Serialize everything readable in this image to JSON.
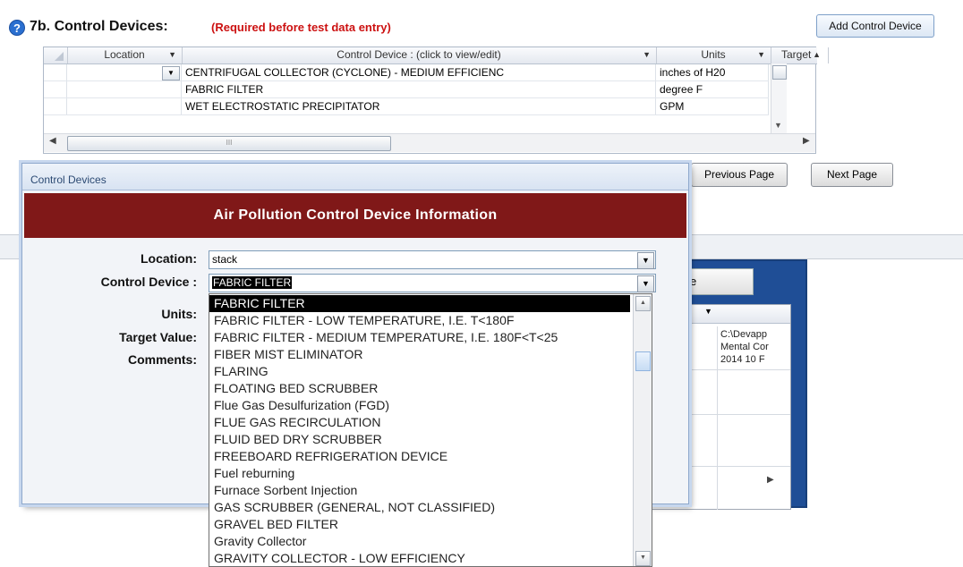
{
  "header": {
    "help_icon": "?",
    "title": "7b.  Control Devices:",
    "required_note": "(Required before test data entry)",
    "add_button": "Add Control Device"
  },
  "grid": {
    "columns": [
      "Location",
      "Control Device :  (click to view/edit)",
      "Units",
      "Target"
    ],
    "rows": [
      {
        "location": "",
        "device": "CENTRIFUGAL COLLECTOR (CYCLONE) - MEDIUM EFFICIENC",
        "units": "inches of H20"
      },
      {
        "location": "",
        "device": "FABRIC FILTER",
        "units": "degree F"
      },
      {
        "location": "",
        "device": "WET ELECTROSTATIC PRECIPITATOR",
        "units": "GPM"
      }
    ],
    "scroll_grip": "III"
  },
  "paging": {
    "previous": "Previous Page",
    "next": "Next Page"
  },
  "background": {
    "button_fragment": "e",
    "path_lines": [
      "C:\\Devapp",
      "Mental Cor",
      "2014 10 F"
    ]
  },
  "dialog": {
    "title": "Control Devices",
    "banner": "Air Pollution Control Device  Information",
    "location_label": "Location:",
    "location_value": "stack",
    "device_label": "Control Device :",
    "device_value": "FABRIC FILTER",
    "units_label": "Units:",
    "target_label": "Target Value:",
    "comments_label": "Comments:"
  },
  "dropdown": {
    "selected_index": 0,
    "items": [
      "FABRIC FILTER",
      "FABRIC FILTER - LOW TEMPERATURE, I.E. T<180F",
      "FABRIC FILTER - MEDIUM TEMPERATURE, I.E. 180F<T<25",
      "FIBER MIST ELIMINATOR",
      "FLARING",
      "FLOATING BED SCRUBBER",
      "Flue Gas Desulfurization (FGD)",
      "FLUE GAS RECIRCULATION",
      "FLUID BED DRY SCRUBBER",
      "FREEBOARD REFRIGERATION DEVICE",
      "Fuel reburning",
      "Furnace Sorbent Injection",
      "GAS SCRUBBER (GENERAL, NOT CLASSIFIED)",
      "GRAVEL BED FILTER",
      "Gravity Collector",
      "GRAVITY COLLECTOR - LOW EFFICIENCY"
    ]
  }
}
